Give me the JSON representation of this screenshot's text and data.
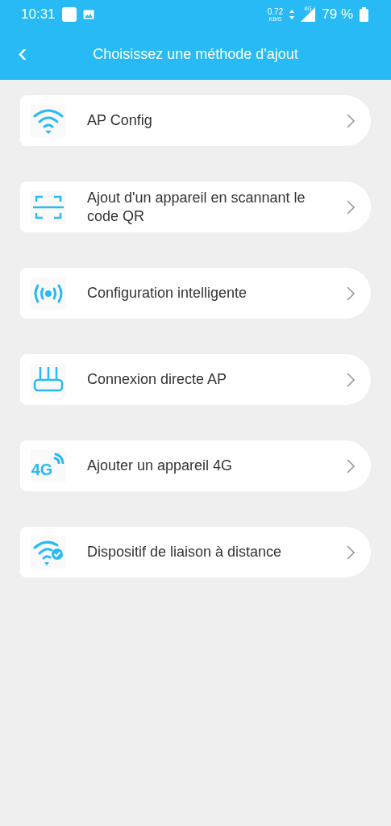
{
  "status_bar": {
    "time": "10:31",
    "speed": "0.72",
    "speed_unit": "KB/S",
    "network": "4G",
    "battery": "79 %"
  },
  "header": {
    "back": "‹",
    "title": "Choisissez une méthode d'ajout"
  },
  "methods": [
    {
      "kind": "wifi",
      "label": "AP Config"
    },
    {
      "kind": "qr",
      "label": "Ajout d'un appareil en scannant le code QR"
    },
    {
      "kind": "broadcast",
      "label": "Configuration intelligente"
    },
    {
      "kind": "router",
      "label": "Connexion directe AP"
    },
    {
      "kind": "cellular",
      "icon_text": "4G",
      "label": "Ajouter un appareil 4G"
    },
    {
      "kind": "wifi-check",
      "label": "Dispositif de liaison à distance"
    }
  ]
}
